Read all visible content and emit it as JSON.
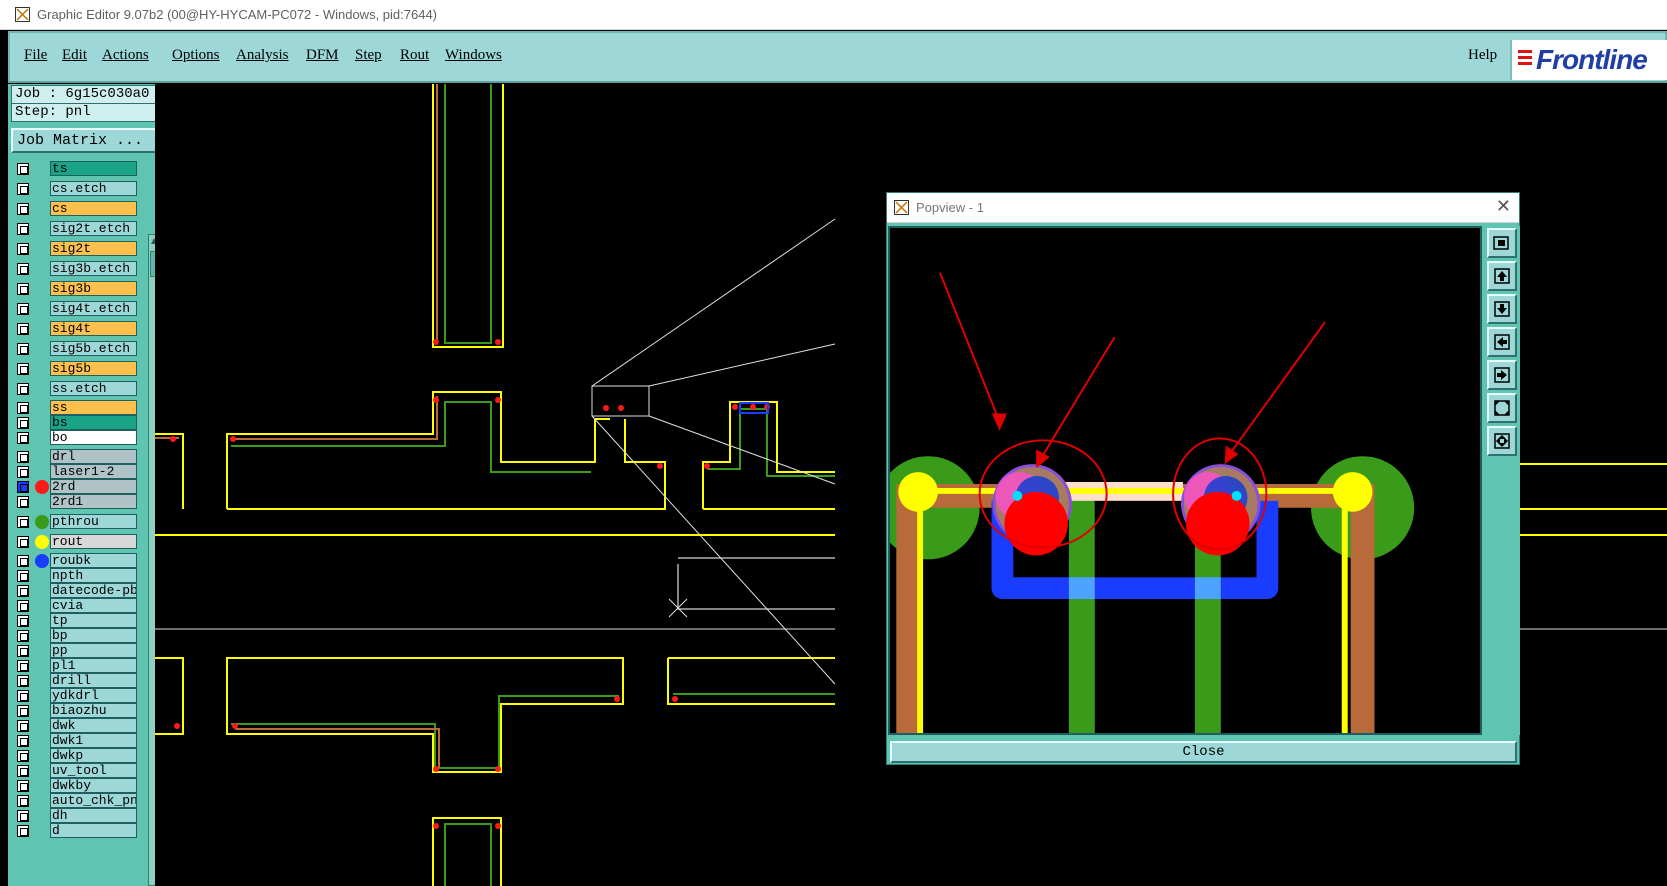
{
  "window": {
    "title": "Graphic Editor 9.07b2 (00@HY-HYCAM-PC072 - Windows, pid:7644)"
  },
  "menu": {
    "items": [
      "File",
      "Edit",
      "Actions",
      "Options",
      "Analysis",
      "DFM",
      "Step",
      "Rout",
      "Windows"
    ],
    "help": "Help"
  },
  "logo": {
    "text": "Frontline"
  },
  "job": {
    "job_line": "Job : 6g15c030a0",
    "step_line": "Step: pnl",
    "matrix_button": "Job Matrix ..."
  },
  "layers": [
    {
      "name": "ts",
      "color": "#1aa387"
    },
    {
      "name": "cs.etch",
      "color": "#9dd7d7"
    },
    {
      "name": "cs",
      "color": "#ffc04d"
    },
    {
      "name": "sig2t.etch",
      "color": "#9dd7d7"
    },
    {
      "name": "sig2t",
      "color": "#ffc04d"
    },
    {
      "name": "sig3b.etch",
      "color": "#9dd7d7"
    },
    {
      "name": "sig3b",
      "color": "#ffc04d"
    },
    {
      "name": "sig4t.etch",
      "color": "#9dd7d7"
    },
    {
      "name": "sig4t",
      "color": "#ffc04d"
    },
    {
      "name": "sig5b.etch",
      "color": "#9dd7d7"
    },
    {
      "name": "sig5b",
      "color": "#ffc04d"
    },
    {
      "name": "ss.etch",
      "color": "#9dd7d7"
    },
    {
      "name": "ss",
      "color": "#ffc04d"
    },
    {
      "name": "bs",
      "color": "#1aa387"
    },
    {
      "name": "bo",
      "color": "#ffffff"
    },
    {
      "name": "drl",
      "color": "#b0c4c8"
    },
    {
      "name": "laser1-2",
      "color": "#b0c4c8"
    },
    {
      "name": "2rd",
      "color": "#b0c4c8",
      "dot": "#ff1a1a",
      "active": true
    },
    {
      "name": "2rd1",
      "color": "#b0c4c8"
    },
    {
      "name": "pthrou",
      "color": "#9dd7d7",
      "dot": "#3a9a1a"
    },
    {
      "name": "rout",
      "color": "#d8d8d8",
      "dot": "#ffff00"
    },
    {
      "name": "roubk",
      "color": "#9dd7d7",
      "dot": "#1a3cff"
    },
    {
      "name": "npth",
      "color": "#9dd7d7"
    },
    {
      "name": "datecode-pbc",
      "color": "#9dd7d7"
    },
    {
      "name": "cvia",
      "color": "#9dd7d7"
    },
    {
      "name": "tp",
      "color": "#9dd7d7"
    },
    {
      "name": "bp",
      "color": "#9dd7d7"
    },
    {
      "name": "pp",
      "color": "#9dd7d7"
    },
    {
      "name": "pl1",
      "color": "#9dd7d7"
    },
    {
      "name": "drill",
      "color": "#9dd7d7"
    },
    {
      "name": "ydkdrl",
      "color": "#9dd7d7"
    },
    {
      "name": "biaozhu",
      "color": "#9dd7d7"
    },
    {
      "name": "dwk",
      "color": "#9dd7d7"
    },
    {
      "name": "dwk1",
      "color": "#9dd7d7"
    },
    {
      "name": "dwkp",
      "color": "#9dd7d7"
    },
    {
      "name": "uv_tool",
      "color": "#9dd7d7"
    },
    {
      "name": "dwkby",
      "color": "#9dd7d7"
    },
    {
      "name": "auto_chk_pnl",
      "color": "#9dd7d7"
    },
    {
      "name": "dh",
      "color": "#9dd7d7"
    },
    {
      "name": "d",
      "color": "#9dd7d7"
    }
  ],
  "popview": {
    "title": "Popview - 1",
    "close_label": "Close"
  },
  "colors": {
    "panel": "#5fc4b0",
    "menubar": "#9dd7d7",
    "rout": "#ffff00",
    "pthrou": "#3a9a1a",
    "copper": "#b86a3a",
    "roubk": "#1a3cff",
    "drill": "#ff1a1a",
    "annotation": "#e00000"
  },
  "icons": [
    "window-icon",
    "popview-icon",
    "close-x-icon",
    "zoom-out-icon",
    "pan-up-icon",
    "pan-down-icon",
    "pan-left-icon",
    "pan-right-icon",
    "fit-screen-icon",
    "fit-width-icon",
    "scroll-up-icon"
  ]
}
